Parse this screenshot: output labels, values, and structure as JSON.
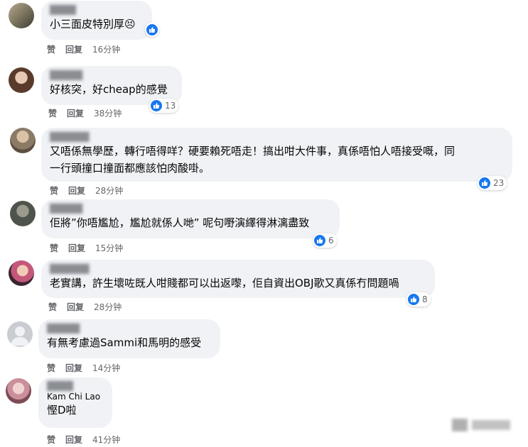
{
  "colors": {
    "bubble": "#f0f2f5",
    "like_blue": "#1877f2",
    "meta_text": "#65676b"
  },
  "comments": [
    {
      "author": "",
      "text_lines": [
        "小三面皮特別厚😣"
      ],
      "actions": {
        "like": "赞",
        "reply": "回复",
        "time": "16分钟"
      },
      "reaction_count": ""
    },
    {
      "author": "",
      "text_lines": [
        "好核突，好cheap的感覺"
      ],
      "actions": {
        "like": "赞",
        "reply": "回复",
        "time": "38分钟"
      },
      "reaction_count": "13"
    },
    {
      "author": "",
      "text_lines": [
        "又唔係無學歷，轉行唔得咩？硬要賴死唔走！搞出咁大件事，真係唔怕人唔接受嘅，同",
        "一行頭撞口撞面都應該怕肉酸啩。"
      ],
      "actions": {
        "like": "赞",
        "reply": "回复",
        "time": "28分钟"
      },
      "reaction_count": "23"
    },
    {
      "author": "",
      "text_lines": [
        "佢將”你唔尷尬，尷尬就係人哋” 呢句嘢演繹得淋漓盡致"
      ],
      "actions": {
        "like": "赞",
        "reply": "回复",
        "time": "15分钟"
      },
      "reaction_count": "6"
    },
    {
      "author": "",
      "text_lines": [
        "老實講，許生壞咗既人咁賤都可以出返嚟，佢自資出OBJ歌又真係冇問題喎"
      ],
      "actions": {
        "like": "赞",
        "reply": "回复",
        "time": "28分钟"
      },
      "reaction_count": "8"
    },
    {
      "author": "",
      "text_lines": [
        "有無考慮過Sammi和馬明的感受"
      ],
      "actions": {
        "like": "赞",
        "reply": "回复",
        "time": "14分钟"
      },
      "reaction_count": ""
    },
    {
      "author": "Kam Chi Lao",
      "text_lines": [
        "慳D啦"
      ],
      "actions": {
        "like": "赞",
        "reply": "回复",
        "time": "41分钟"
      },
      "reaction_count": ""
    }
  ]
}
